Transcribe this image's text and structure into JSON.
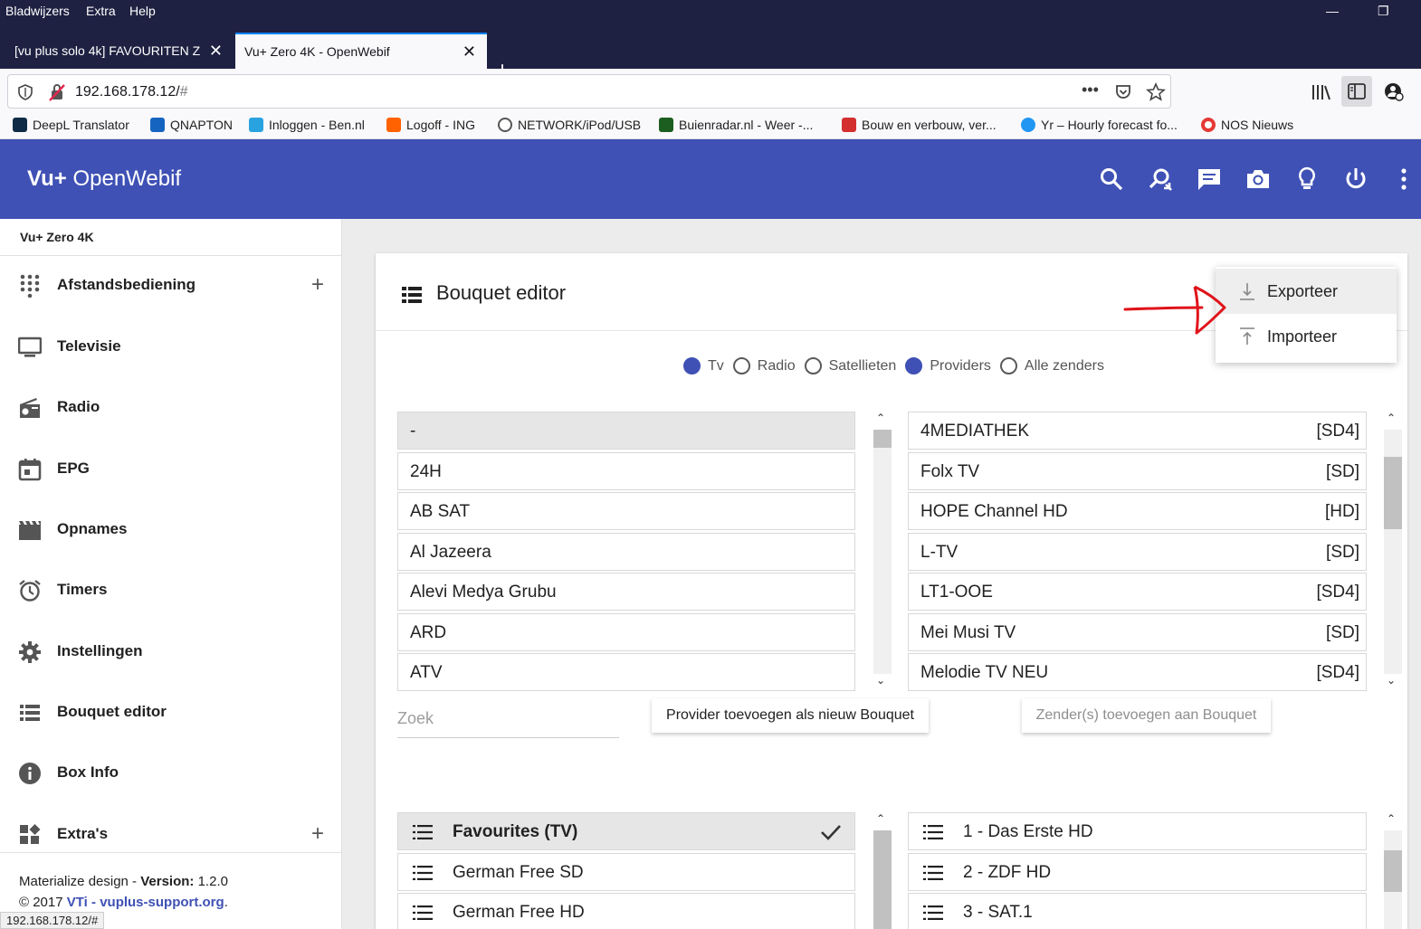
{
  "browser": {
    "menu": [
      "Bladwijzers",
      "Extra",
      "Help"
    ],
    "tabs": [
      {
        "title": "[vu plus solo 4k] FAVOURITEN Z",
        "active": false
      },
      {
        "title": "Vu+ Zero 4K - OpenWebif",
        "active": true
      }
    ],
    "url": "192.168.178.12/",
    "url_hash": "#",
    "bookmarks": [
      {
        "label": "DeepL Translator",
        "color": "#0f2b46"
      },
      {
        "label": "QNAPTON",
        "color": "#1565c0"
      },
      {
        "label": "Inloggen - Ben.nl",
        "color": "#29a3e0"
      },
      {
        "label": "Logoff - ING",
        "color": "#ff6200"
      },
      {
        "label": "NETWORK/iPod/USB",
        "color": "#555555"
      },
      {
        "label": "Buienradar.nl - Weer -...",
        "color": "#1b5e20"
      },
      {
        "label": "Bouw en verbouw, ver...",
        "color": "#d32f2f"
      },
      {
        "label": "Yr – Hourly forecast fo...",
        "color": "#2196f3"
      },
      {
        "label": "NOS Nieuws",
        "color": "#e53935"
      }
    ],
    "status_url": "192.168.178.12/#"
  },
  "app": {
    "brand_bold": "Vu+",
    "brand_rest": " OpenWebif",
    "accent": "#3f51b5",
    "header_icons": [
      "search-icon",
      "zoom-search-icon",
      "message-icon",
      "camera-icon",
      "lightbulb-icon",
      "power-icon",
      "more-vert-icon"
    ]
  },
  "sidebar": {
    "title": "Vu+ Zero 4K",
    "items": [
      {
        "label": "Afstandsbediening",
        "icon": "remote-dialpad-icon",
        "expandable": true
      },
      {
        "label": "Televisie",
        "icon": "tv-icon",
        "expandable": false
      },
      {
        "label": "Radio",
        "icon": "radio-icon",
        "expandable": false
      },
      {
        "label": "EPG",
        "icon": "calendar-icon",
        "expandable": false
      },
      {
        "label": "Opnames",
        "icon": "movie-icon",
        "expandable": false
      },
      {
        "label": "Timers",
        "icon": "alarm-icon",
        "expandable": false
      },
      {
        "label": "Instellingen",
        "icon": "settings-icon",
        "expandable": false
      },
      {
        "label": "Bouquet editor",
        "icon": "list-icon",
        "expandable": false
      },
      {
        "label": "Box Info",
        "icon": "info-icon",
        "expandable": false
      },
      {
        "label": "Extra's",
        "icon": "widgets-icon",
        "expandable": true
      }
    ],
    "footer": {
      "line1_prefix": "Materialize design - ",
      "line1_bold": "Version:",
      "line1_value": " 1.2.0",
      "line2_prefix": "© 2017 ",
      "line2_link1": "VTi",
      "line2_mid": " - ",
      "line2_link2": "vuplus-support.org",
      "line2_suffix": "."
    }
  },
  "editor": {
    "title": "Bouquet editor",
    "radios": [
      {
        "label": "Tv",
        "checked": true
      },
      {
        "label": "Radio",
        "checked": false
      },
      {
        "label": "Satellieten",
        "checked": false
      },
      {
        "label": "Providers",
        "checked": true
      },
      {
        "label": "Alle zenders",
        "checked": false
      }
    ],
    "providers": [
      "-",
      "24H",
      "AB SAT",
      "Al Jazeera",
      "Alevi Medya Grubu",
      "ARD",
      "ATV"
    ],
    "channels": [
      {
        "name": "4MEDIATHEK",
        "tag": "[SD4]"
      },
      {
        "name": "Folx TV",
        "tag": "[SD]"
      },
      {
        "name": "HOPE Channel HD",
        "tag": "[HD]"
      },
      {
        "name": "L-TV",
        "tag": "[SD]"
      },
      {
        "name": "LT1-OOE",
        "tag": "[SD4]"
      },
      {
        "name": "Mei Musi TV",
        "tag": "[SD]"
      },
      {
        "name": "Melodie TV NEU",
        "tag": "[SD4]"
      }
    ],
    "search_placeholder": "Zoek",
    "add_provider_button": "Provider toevoegen als nieuw Bouquet",
    "add_channel_button": "Zender(s) toevoegen aan Bouquet",
    "bouquets": [
      "Favourites (TV)",
      "German Free SD",
      "German Free HD"
    ],
    "bouquet_channels": [
      "1 - Das Erste HD",
      "2 - ZDF HD",
      "3 - SAT.1"
    ]
  },
  "dropdown": {
    "items": [
      {
        "label": "Exporteer",
        "icon": "download-icon"
      },
      {
        "label": "Importeer",
        "icon": "upload-icon"
      }
    ]
  }
}
